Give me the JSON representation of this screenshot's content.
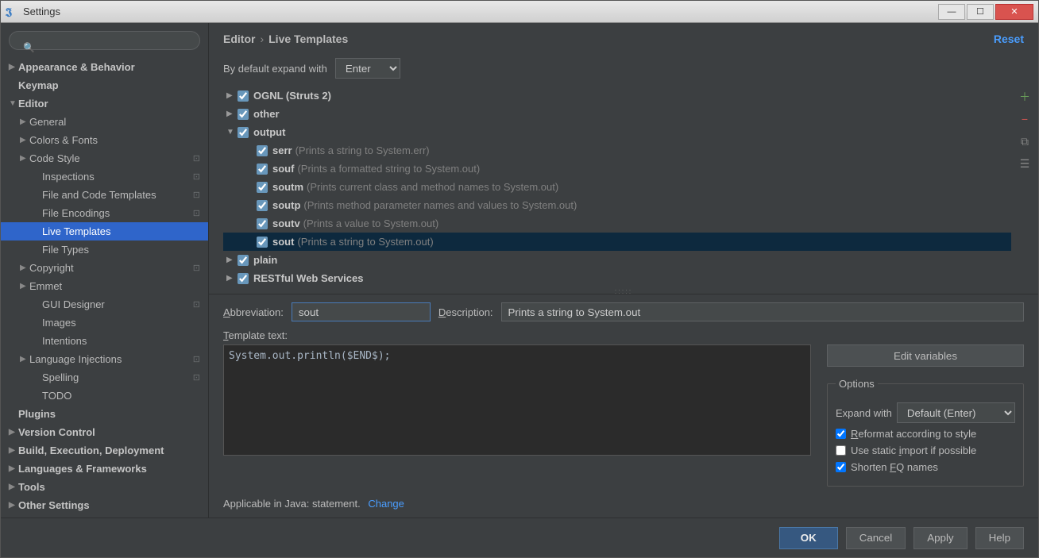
{
  "window": {
    "title": "Settings"
  },
  "search": {
    "placeholder": ""
  },
  "sidebar": [
    {
      "label": "Appearance & Behavior",
      "bold": true,
      "arrow": "▶",
      "indent": 0
    },
    {
      "label": "Keymap",
      "bold": true,
      "arrow": "",
      "indent": 0
    },
    {
      "label": "Editor",
      "bold": true,
      "arrow": "▼",
      "indent": 0
    },
    {
      "label": "General",
      "arrow": "▶",
      "indent": 1
    },
    {
      "label": "Colors & Fonts",
      "arrow": "▶",
      "indent": 1
    },
    {
      "label": "Code Style",
      "arrow": "▶",
      "indent": 1,
      "pin": true
    },
    {
      "label": "Inspections",
      "arrow": "",
      "indent": 2,
      "pin": true
    },
    {
      "label": "File and Code Templates",
      "arrow": "",
      "indent": 2,
      "pin": true
    },
    {
      "label": "File Encodings",
      "arrow": "",
      "indent": 2,
      "pin": true
    },
    {
      "label": "Live Templates",
      "arrow": "",
      "indent": 2,
      "selected": true
    },
    {
      "label": "File Types",
      "arrow": "",
      "indent": 2
    },
    {
      "label": "Copyright",
      "arrow": "▶",
      "indent": 1,
      "pin": true
    },
    {
      "label": "Emmet",
      "arrow": "▶",
      "indent": 1
    },
    {
      "label": "GUI Designer",
      "arrow": "",
      "indent": 2,
      "pin": true
    },
    {
      "label": "Images",
      "arrow": "",
      "indent": 2
    },
    {
      "label": "Intentions",
      "arrow": "",
      "indent": 2
    },
    {
      "label": "Language Injections",
      "arrow": "▶",
      "indent": 1,
      "pin": true
    },
    {
      "label": "Spelling",
      "arrow": "",
      "indent": 2,
      "pin": true
    },
    {
      "label": "TODO",
      "arrow": "",
      "indent": 2
    },
    {
      "label": "Plugins",
      "bold": true,
      "arrow": "",
      "indent": 0
    },
    {
      "label": "Version Control",
      "bold": true,
      "arrow": "▶",
      "indent": 0
    },
    {
      "label": "Build, Execution, Deployment",
      "bold": true,
      "arrow": "▶",
      "indent": 0
    },
    {
      "label": "Languages & Frameworks",
      "bold": true,
      "arrow": "▶",
      "indent": 0
    },
    {
      "label": "Tools",
      "bold": true,
      "arrow": "▶",
      "indent": 0
    },
    {
      "label": "Other Settings",
      "bold": true,
      "arrow": "▶",
      "indent": 0
    }
  ],
  "breadcrumb": {
    "a": "Editor",
    "b": "Live Templates",
    "reset": "Reset"
  },
  "expand": {
    "label": "By default expand with",
    "value": "Enter"
  },
  "groups": [
    {
      "label": "OGNL (Struts 2)",
      "arrow": "▶",
      "checked": true
    },
    {
      "label": "other",
      "arrow": "▶",
      "checked": true
    },
    {
      "label": "output",
      "arrow": "▼",
      "checked": true,
      "children": [
        {
          "name": "serr",
          "desc": "(Prints a string to System.err)",
          "checked": true
        },
        {
          "name": "souf",
          "desc": "(Prints a formatted string to System.out)",
          "checked": true
        },
        {
          "name": "soutm",
          "desc": "(Prints current class and method names to System.out)",
          "checked": true
        },
        {
          "name": "soutp",
          "desc": "(Prints method parameter names and values to System.out)",
          "checked": true
        },
        {
          "name": "soutv",
          "desc": "(Prints a value to System.out)",
          "checked": true
        },
        {
          "name": "sout",
          "desc": "(Prints a string to System.out)",
          "checked": true,
          "selected": true
        }
      ]
    },
    {
      "label": "plain",
      "arrow": "▶",
      "checked": true
    },
    {
      "label": "RESTful Web Services",
      "arrow": "▶",
      "checked": true
    }
  ],
  "form": {
    "abbrev_label": "Abbreviation:",
    "abbrev_value": "sout",
    "desc_label": "Description:",
    "desc_value": "Prints a string to System.out",
    "tt_label": "Template text:",
    "tt_value": "System.out.println($END$);",
    "editvars": "Edit variables",
    "options_legend": "Options",
    "expandwith_label": "Expand with",
    "expandwith_value": "Default (Enter)",
    "opt1": "Reformat according to style",
    "opt2": "Use static import if possible",
    "opt3": "Shorten FQ names",
    "applicable": "Applicable in Java: statement.",
    "change": "Change"
  },
  "footer": {
    "ok": "OK",
    "cancel": "Cancel",
    "apply": "Apply",
    "help": "Help"
  }
}
